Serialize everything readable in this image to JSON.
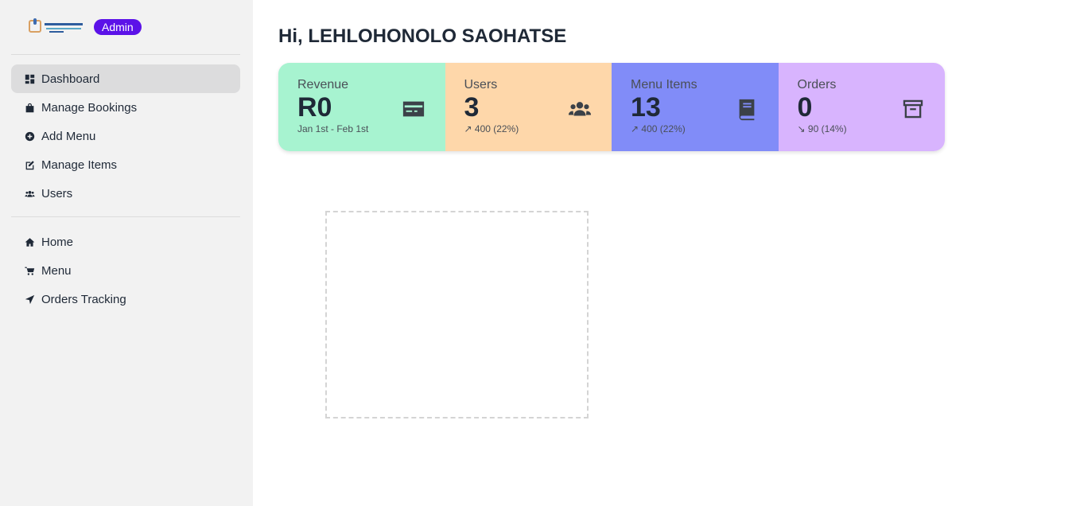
{
  "sidebar": {
    "badge": "Admin",
    "primary_items": [
      {
        "label": "Dashboard",
        "icon": "dashboard-icon"
      },
      {
        "label": "Manage Bookings",
        "icon": "shopping-bag-icon"
      },
      {
        "label": "Add Menu",
        "icon": "plus-circle-icon"
      },
      {
        "label": "Manage Items",
        "icon": "edit-icon"
      },
      {
        "label": "Users",
        "icon": "users-icon"
      }
    ],
    "secondary_items": [
      {
        "label": "Home",
        "icon": "home-icon"
      },
      {
        "label": "Menu",
        "icon": "cart-icon"
      },
      {
        "label": "Orders Tracking",
        "icon": "location-arrow-icon"
      }
    ]
  },
  "main": {
    "greeting": "Hi, LEHLOHONOLO SAOHATSE",
    "stats": [
      {
        "title": "Revenue",
        "value": "R0",
        "desc": "Jan 1st - Feb 1st",
        "icon": "credit-card-icon",
        "color": "#a7f3d0"
      },
      {
        "title": "Users",
        "value": "3",
        "desc": "↗︎ 400 (22%)",
        "icon": "users-icon",
        "color": "#fed7aa"
      },
      {
        "title": "Menu Items",
        "value": "13",
        "desc": "↗︎ 400 (22%)",
        "icon": "book-icon",
        "color": "#818cf8"
      },
      {
        "title": "Orders",
        "value": "0",
        "desc": "↘︎ 90 (14%)",
        "icon": "archive-icon",
        "color": "#d8b4fe"
      }
    ]
  },
  "colors": {
    "accent": "#5b12e8",
    "sidebar_bg": "#f2f2f2",
    "active_item_bg": "#dcdcdd"
  }
}
